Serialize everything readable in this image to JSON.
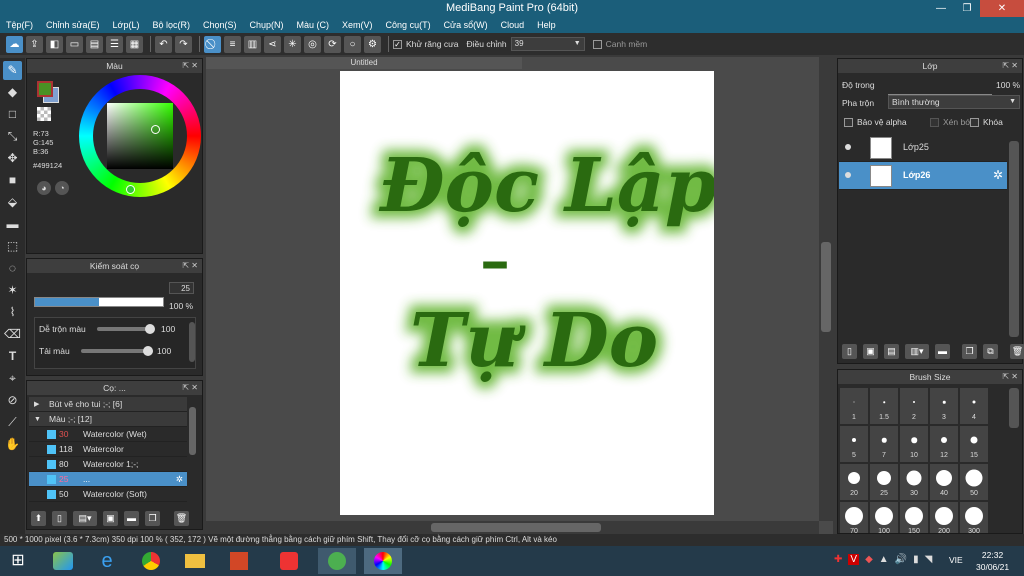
{
  "app": {
    "title": "MediBang Paint Pro (64bit)"
  },
  "window_controls": {
    "minimize": "—",
    "restore": "❐",
    "close": "✕"
  },
  "menu": [
    "Tệp(F)",
    "Chỉnh sửa(E)",
    "Lớp(L)",
    "Bộ lọc(R)",
    "Chọn(S)",
    "Chụp(N)",
    "Màu (C)",
    "Xem(V)",
    "Công cụ(T)",
    "Cửa sổ(W)",
    "Cloud",
    "Help"
  ],
  "toolbar": {
    "antialias_label": "Khử răng cưa",
    "adjust_label": "Điều chỉnh",
    "adjust_value": "39",
    "smooth_label": "Canh mềm"
  },
  "color_panel": {
    "title": "Màu",
    "r": "R:73",
    "g": "G:145",
    "b": "B:36",
    "hex": "#499124",
    "primary_color": "#499124",
    "secondary_color": "#7fa0d0"
  },
  "brush_control": {
    "title": "Kiểm soát cọ",
    "size_value": "25",
    "size_fraction": 0.5,
    "opacity_value": "100 %",
    "opacity_fraction": 1.0,
    "blend_label": "Dễ trộn màu",
    "blend_value": "100",
    "resample_label": "Tải màu",
    "resample_value": "100"
  },
  "brush_panel": {
    "title": "Cọ: ...",
    "groups": [
      {
        "label": "Bút vẽ cho tui ;-; [6]"
      },
      {
        "label": "Màu ;-; [12]"
      }
    ],
    "items": [
      {
        "size": "30",
        "name": "Watercolor (Wet)",
        "size_color": "#e05050"
      },
      {
        "size": "118",
        "name": "Watercolor",
        "size_color": "#dddddd"
      },
      {
        "size": "80",
        "name": "Watercolor 1;-;",
        "size_color": "#dddddd"
      },
      {
        "size": "25",
        "name": "...",
        "size_color": "#ff6b9a"
      },
      {
        "size": "50",
        "name": "Watercolor (Soft)",
        "size_color": "#dddddd"
      }
    ]
  },
  "canvas": {
    "tab": "Untitled",
    "line1": "Độc Lập",
    "line2": "Tự Do",
    "dash": "–",
    "ink_color": "#2a6a10",
    "glow_color": "#6ab83a"
  },
  "layer_panel": {
    "title": "Lớp",
    "opacity_label": "Độ trong",
    "opacity_value": "100 %",
    "opacity_fraction": 1.0,
    "blend_label": "Pha trộn",
    "blend_value": "Bình thường",
    "alpha_lock": "Bảo vệ alpha",
    "clip": "Xén bớt",
    "lock": "Khóa",
    "layers": [
      {
        "name": "Lớp25"
      },
      {
        "name": "Lớp26"
      }
    ]
  },
  "brush_size": {
    "title": "Brush Size",
    "sizes": [
      "1",
      "1.5",
      "2",
      "3",
      "4",
      "5",
      "7",
      "10",
      "12",
      "15",
      "20",
      "25",
      "30",
      "40",
      "50",
      "70",
      "100",
      "150",
      "200",
      "300"
    ]
  },
  "status": {
    "text": "500 * 1000 pixel   (3.6 * 7.3cm)   350 dpi   100 %   ( 352, 172 )   Vẽ một đường thẳng bằng cách giữ phím Shift, Thay đổi cỡ cọ bằng cách giữ phím Ctrl, Alt và kéo"
  },
  "taskbar": {
    "lang": "VIE",
    "time": "22:32",
    "date": "30/06/21"
  }
}
